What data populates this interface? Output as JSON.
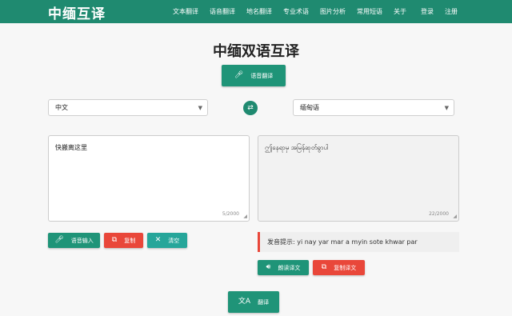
{
  "nav": {
    "brand": "中缅互译",
    "items": [
      "文本翻译",
      "语音翻译",
      "地名翻译",
      "专业术语",
      "图片分析",
      "常用短语",
      "关于",
      "登录",
      "注册"
    ]
  },
  "page_title": "中缅双语互译",
  "voice_translate_label": "语音翻译",
  "source_language": "中文",
  "target_language": "缅甸语",
  "source_text": "快搬离这里",
  "source_count": "5/2000",
  "target_text": "ဤနေရာမှ အမြန်ဆုတ်ခွာပါ",
  "target_count": "22/2000",
  "buttons": {
    "voice_input": "语音输入",
    "copy": "复制",
    "clear": "清空",
    "read_aloud": "朗读译文",
    "copy_translation": "复制译文",
    "translate": "翻译"
  },
  "pronunciation_hint": "发音提示: yi nay yar mar a myin sote khwar par",
  "icons": {
    "voice": "microphone-icon",
    "swap": "swap-icon",
    "copy": "copy-icon",
    "clear": "close-icon",
    "read": "speaker-icon",
    "translate": "translate-icon"
  },
  "colors": {
    "primary": "#1f8a70",
    "button_green": "#1f9478",
    "button_red": "#e9473a",
    "button_teal": "#26a69a"
  }
}
